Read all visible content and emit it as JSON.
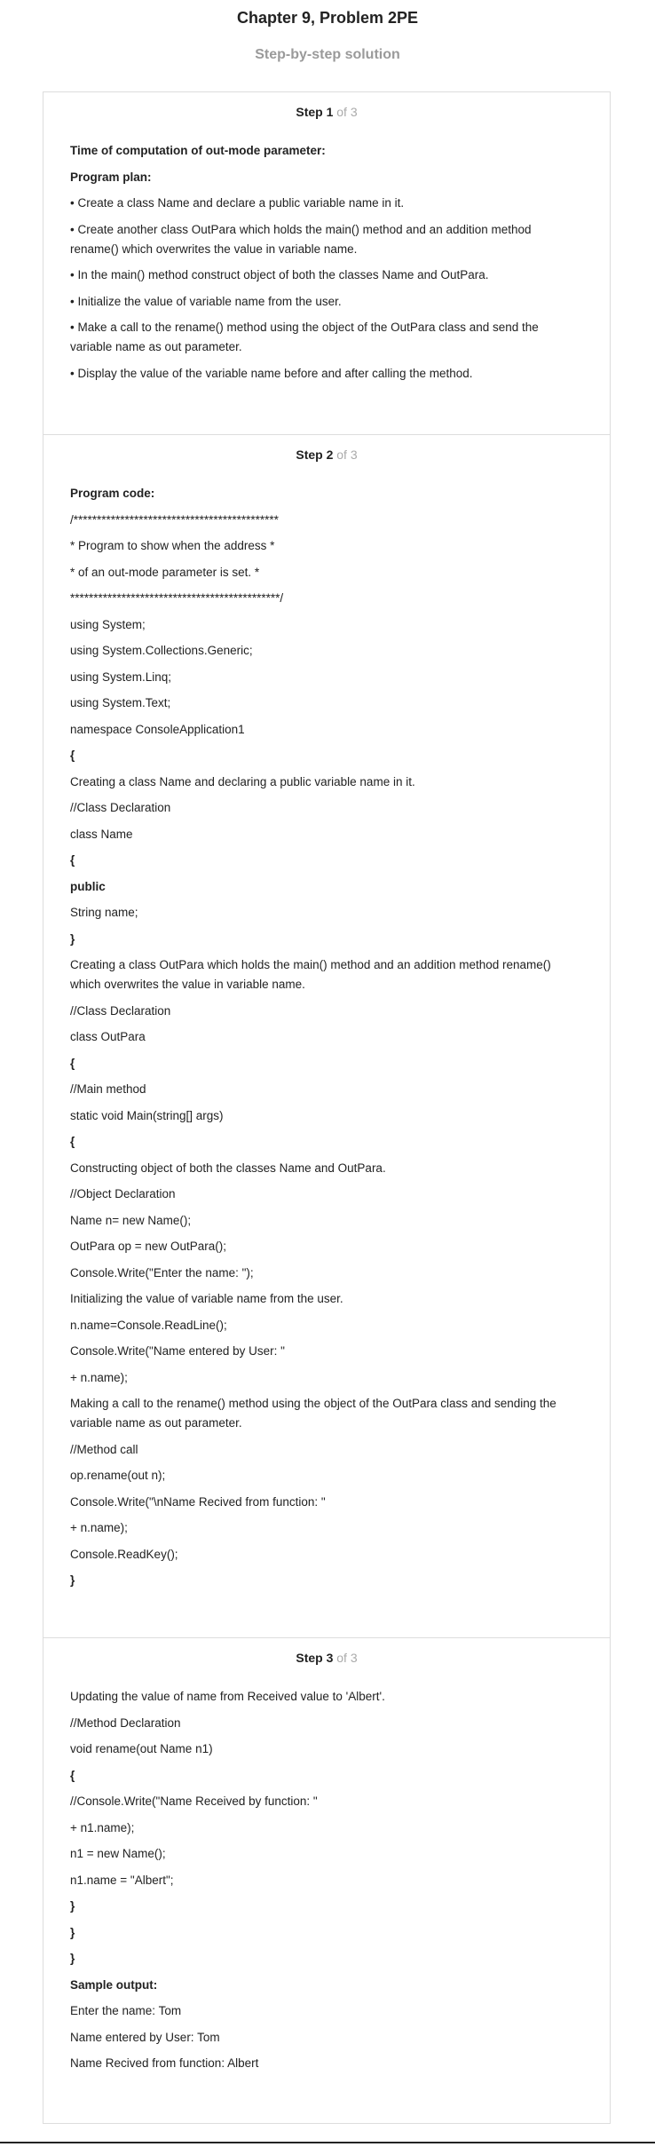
{
  "header": {
    "title": "Chapter 9, Problem 2PE",
    "subtitle": "Step-by-step solution"
  },
  "steps": [
    {
      "label": "Step 1",
      "of": "of 3",
      "lines": [
        "Time of computation of out-mode parameter:",
        "Program plan:",
        "• Create a class Name and declare a public variable name in it.",
        "• Create another class OutPara which holds the main() method and an addition method rename() which overwrites the value in variable name.",
        "• In the main() method construct object of both the classes Name and OutPara.",
        "• Initialize the value of variable name from the user.",
        "• Make a call to the rename() method using the object of the OutPara class and send the variable name as out parameter.",
        "• Display the value of the variable name before and after calling the method."
      ]
    },
    {
      "label": "Step 2",
      "of": "of 3",
      "lines": [
        "Program code:",
        "/********************************************",
        "* Program to show when the address *",
        "* of an out-mode parameter is set. *",
        "*********************************************/",
        "using System;",
        "using System.Collections.Generic;",
        "using System.Linq;",
        "using System.Text;",
        "namespace ConsoleApplication1",
        "{",
        "Creating a class Name and declaring a public variable name in it.",
        "//Class Declaration",
        "class Name",
        "{",
        "public",
        "String name;",
        "}",
        "Creating a class OutPara which holds the main() method and an addition method rename() which overwrites the value in variable name.",
        "//Class Declaration",
        "class OutPara",
        "{",
        "//Main method",
        "static void Main(string[] args)",
        "{",
        "Constructing object of both the classes Name and OutPara.",
        "//Object Declaration",
        "Name n= new Name();",
        "OutPara op = new OutPara();",
        "Console.Write(\"Enter the name: \");",
        "Initializing the value of variable name from the user.",
        "n.name=Console.ReadLine();",
        "Console.Write(\"Name entered by User: \"",
        "+ n.name);",
        "Making a call to the rename() method using the object of the OutPara class and sending the variable name as out parameter.",
        "//Method call",
        "op.rename(out n);",
        "Console.Write(\"\\nName Recived from function: \"",
        "+ n.name);",
        "Console.ReadKey();",
        "}"
      ]
    },
    {
      "label": "Step 3",
      "of": "of 3",
      "lines": [
        "Updating the value of name from Received value to 'Albert'.",
        "//Method Declaration",
        "void rename(out Name n1)",
        "{",
        "//Console.Write(\"Name Received by function: \"",
        "+ n1.name);",
        "n1 = new Name();",
        "n1.name = \"Albert\";",
        "}",
        "}",
        "}",
        "Sample output:",
        "Enter the name: Tom",
        "Name entered by User: Tom",
        "Name Recived from function: Albert"
      ]
    }
  ]
}
